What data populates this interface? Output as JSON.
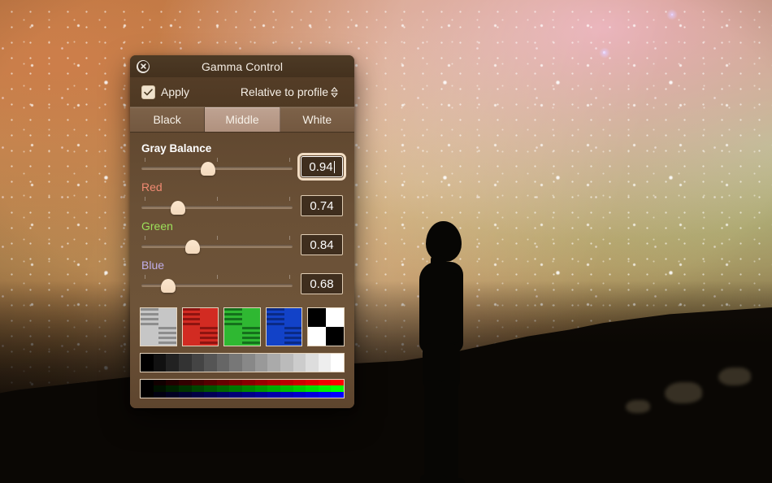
{
  "window": {
    "title": "Gamma Control",
    "close_icon": "close-icon"
  },
  "controls": {
    "apply_label": "Apply",
    "apply_checked": true,
    "mode_popup": {
      "value": "Relative to profile",
      "arrows_icon": "up-down-chevron-icon"
    },
    "segments": [
      {
        "label": "Black",
        "selected": false
      },
      {
        "label": "Middle",
        "selected": true
      },
      {
        "label": "White",
        "selected": false
      }
    ]
  },
  "sliders": [
    {
      "name": "gray",
      "label": "Gray Balance",
      "value": "0.94",
      "position_pct": 44,
      "focused": true,
      "color": "#ffffff"
    },
    {
      "name": "red",
      "label": "Red",
      "value": "0.74",
      "position_pct": 24,
      "focused": false,
      "color": "#f08a72"
    },
    {
      "name": "green",
      "label": "Green",
      "value": "0.84",
      "position_pct": 34,
      "focused": false,
      "color": "#9ce05a"
    },
    {
      "name": "blue",
      "label": "Blue",
      "value": "0.68",
      "position_pct": 18,
      "focused": false,
      "color": "#c0aee8"
    }
  ],
  "swatches": [
    {
      "name": "gray-swatch",
      "solid": "#c6c6c6",
      "stripe_dark": "#8d8d8d"
    },
    {
      "name": "red-swatch",
      "solid": "#d22b22",
      "stripe_dark": "#8e1410"
    },
    {
      "name": "green-swatch",
      "solid": "#2fb832",
      "stripe_dark": "#15701c"
    },
    {
      "name": "blue-swatch",
      "solid": "#1242c8",
      "stripe_dark": "#0a2a85"
    },
    {
      "name": "bw-swatch",
      "solid": "#ffffff",
      "stripe_dark": "#000000"
    }
  ],
  "gray_ramp_steps": 16,
  "rgb_ramp_steps": 16,
  "background": {
    "scene": "night-sky-milky-way-with-person-silhouette"
  }
}
